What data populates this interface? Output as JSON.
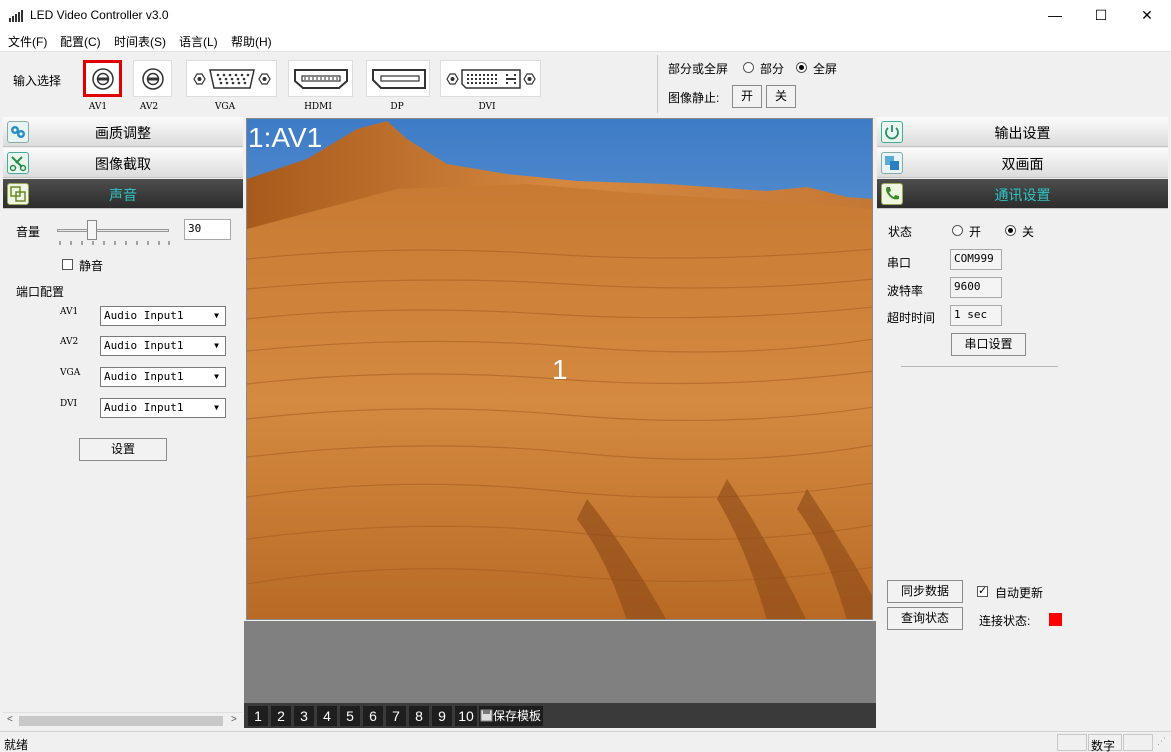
{
  "window": {
    "title": "LED Video Controller v3.0",
    "minimize_glyph": "—",
    "maximize_glyph": "☐",
    "close_glyph": "✕"
  },
  "menu": [
    "文件(F)",
    "配置(C)",
    "时间表(S)",
    "语言(L)",
    "帮助(H)"
  ],
  "input_bar": {
    "label": "输入选择",
    "sources": [
      "AV1",
      "AV2",
      "VGA",
      "HDMI",
      "DP",
      "DVI"
    ],
    "selected": "AV1",
    "partial_full_label": "部分或全屏",
    "partial_option": "部分",
    "full_option": "全屏",
    "full_selected": true,
    "freeze_label": "图像静止:",
    "freeze_on": "开",
    "freeze_off": "关"
  },
  "left_panel": {
    "sections": [
      "画质调整",
      "图像截取",
      "声音"
    ],
    "active_section": "声音",
    "volume_label": "音量",
    "volume_value": "30",
    "mute_label": "静音",
    "port_config_label": "端口配置",
    "ports": [
      {
        "name": "AV1",
        "value": "Audio Input1"
      },
      {
        "name": "AV2",
        "value": "Audio Input1"
      },
      {
        "name": "VGA",
        "value": "Audio Input1"
      },
      {
        "name": "DVI",
        "value": "Audio Input1"
      }
    ],
    "set_button": "设置"
  },
  "preview": {
    "window_label": "1:AV1",
    "center_number": "1"
  },
  "bottom_tabs": {
    "numbers": [
      "1",
      "2",
      "3",
      "4",
      "5",
      "6",
      "7",
      "8",
      "9",
      "10"
    ],
    "save_template": "保存模板"
  },
  "right_panel": {
    "sections": [
      "输出设置",
      "双画面",
      "通讯设置"
    ],
    "active_section": "通讯设置",
    "status_label": "状态",
    "status_on": "开",
    "status_off": "关",
    "status_off_selected": true,
    "serial_label": "串口",
    "serial_value": "COM999",
    "baud_label": "波特率",
    "baud_value": "9600",
    "timeout_label": "超时时间",
    "timeout_value": "1 sec",
    "serial_settings_button": "串口设置",
    "sync_button": "同步数据",
    "auto_update_label": "自动更新",
    "auto_update_checked": true,
    "query_button": "查询状态",
    "connection_label": "连接状态:",
    "connection_color": "#ff0000"
  },
  "status_bar": {
    "status": "就绪",
    "numlock": "数字"
  }
}
